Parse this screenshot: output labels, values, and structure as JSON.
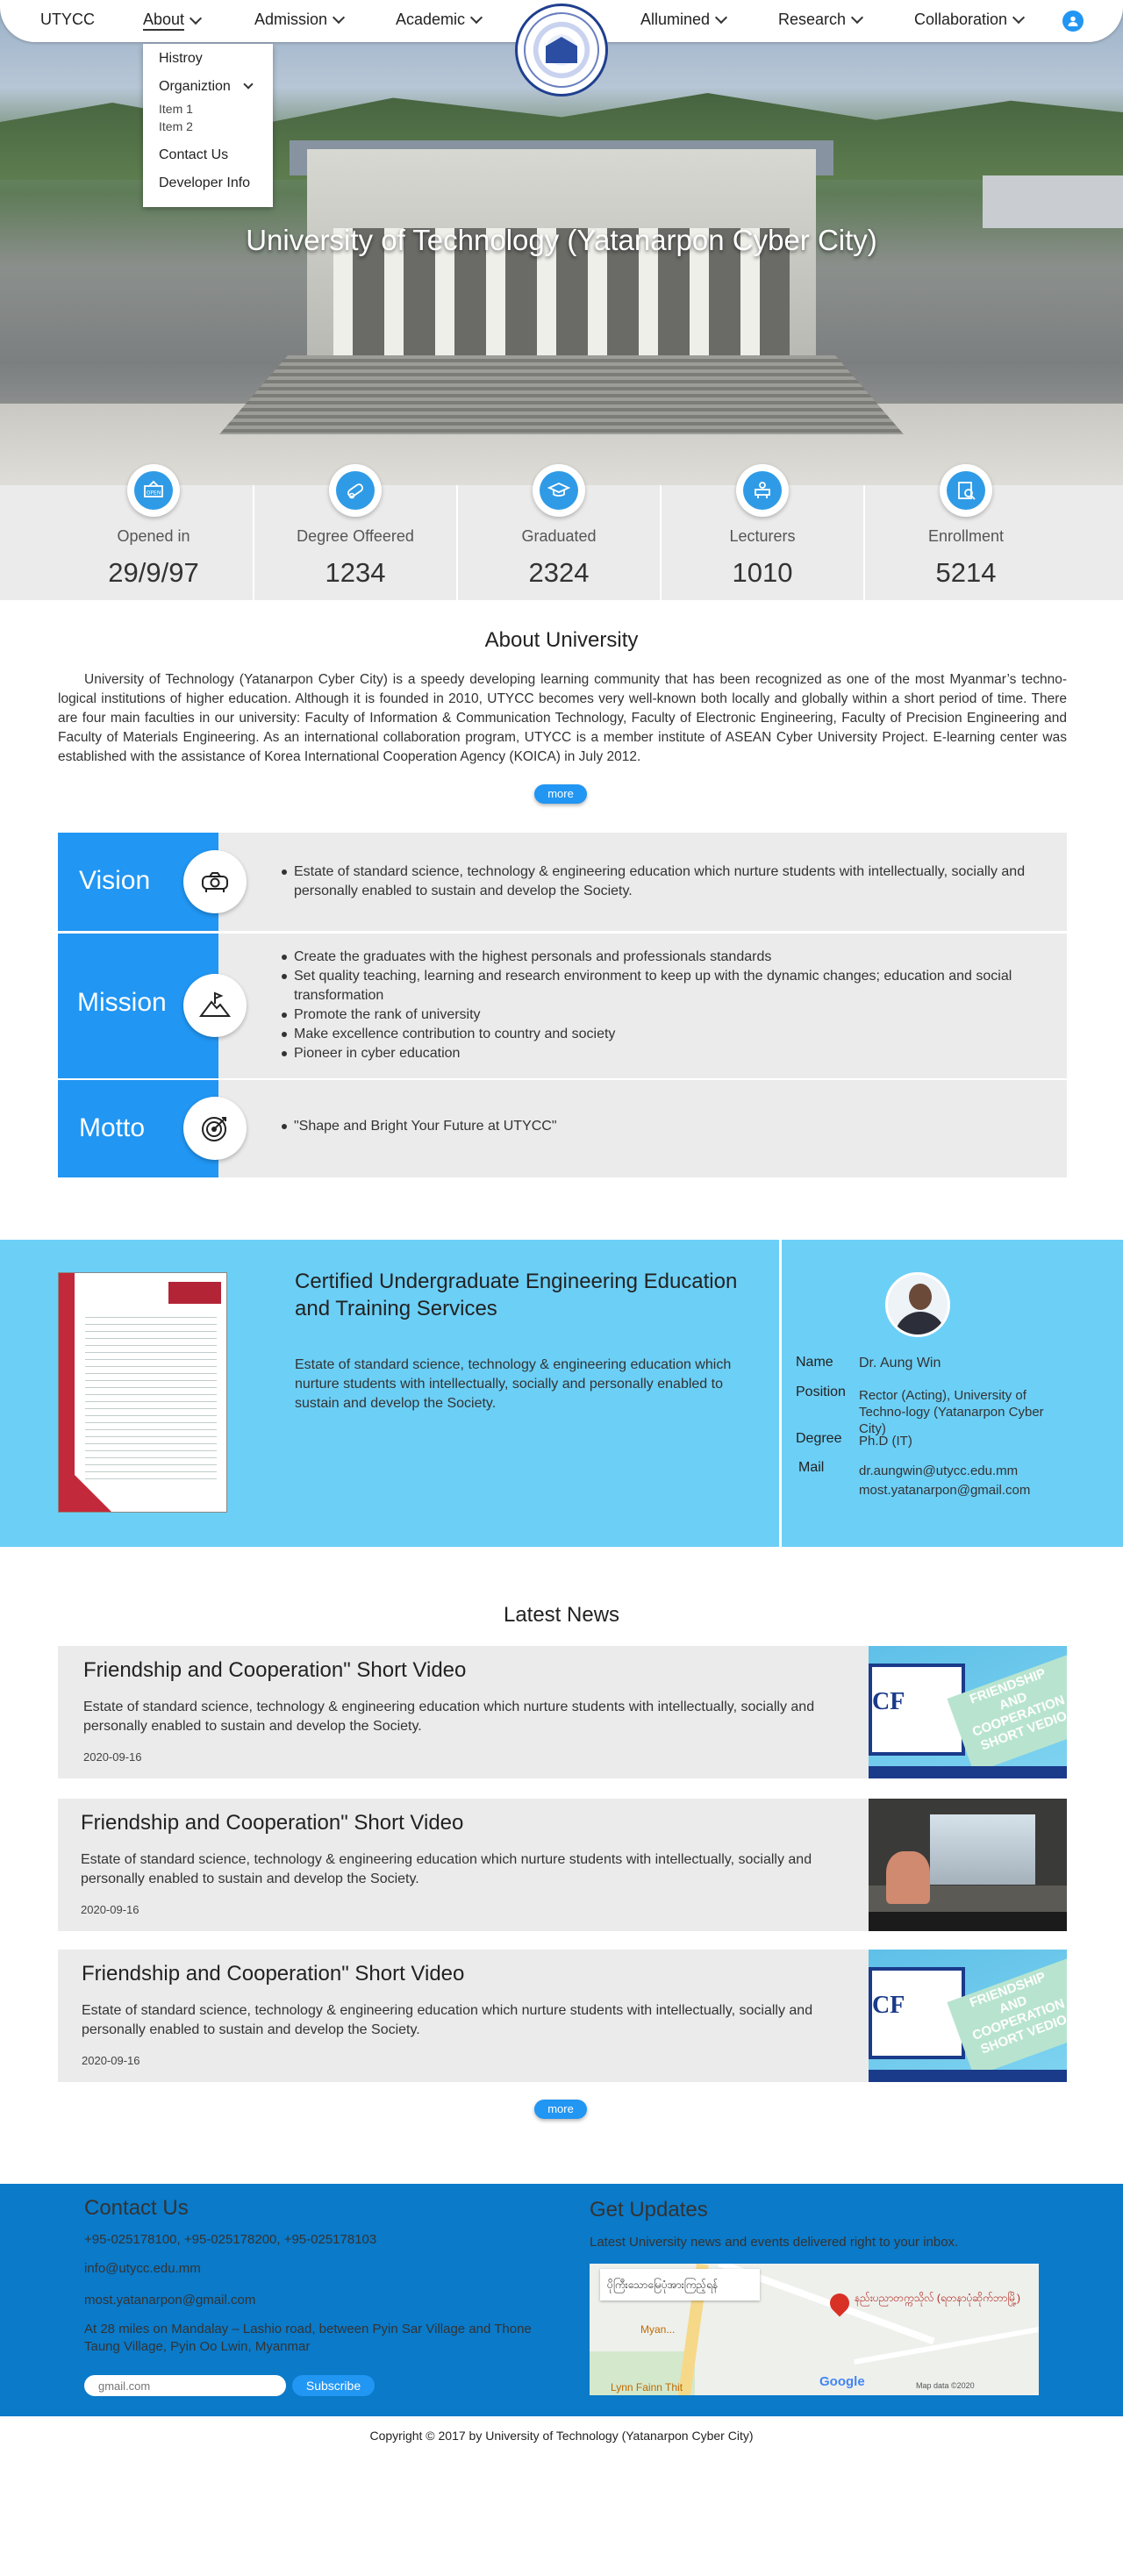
{
  "nav": {
    "brand": "UTYCC",
    "items": [
      {
        "label": "About"
      },
      {
        "label": "Admission"
      },
      {
        "label": "Academic"
      },
      {
        "label": "Allumined"
      },
      {
        "label": "Research"
      },
      {
        "label": "Collaboration"
      }
    ],
    "dropdown": {
      "histroy": "Histroy",
      "organiztion": "Organiztion",
      "item1": "Item 1",
      "item2": "Item 2",
      "contact": "Contact Us",
      "developer": "Developer Info"
    },
    "user_icon": "user-icon"
  },
  "hero": {
    "title": "University of Technology (Yatanarpon Cyber City)"
  },
  "stats": [
    {
      "icon": "open-sign-icon",
      "label": "Opened in",
      "value": "29/9/97"
    },
    {
      "icon": "diploma-icon",
      "label": "Degree Offeered",
      "value": "1234"
    },
    {
      "icon": "graduation-cap-icon",
      "label": "Graduated",
      "value": "2324"
    },
    {
      "icon": "lecturer-icon",
      "label": "Lecturers",
      "value": "1010"
    },
    {
      "icon": "enrollment-icon",
      "label": "Enrollment",
      "value": "5214"
    }
  ],
  "about": {
    "title": "About University",
    "text": "University of Technology (Yatanarpon Cyber City) is a speedy developing learning community that has been recognized as one of the most Myanmar’s techno-logical institutions of higher education. Although it is founded in 2010, UTYCC becomes very well-known both locally and globally within a short period of time. There are four main faculties in our university: Faculty of Information & Communication Technology, Faculty of Electronic Engineering, Faculty of Precision Engineering and Faculty of Materials Engineering. As an international collaboration program, UTYCC is a member institute of ASEAN Cyber University Project. E-learning center was established with the assistance of Korea International Cooperation Agency (KOICA) in July 2012.",
    "more": "more"
  },
  "vision": {
    "title": "Vision",
    "icon": "projector-icon",
    "items": [
      "Estate of standard science, technology & engineering education which nurture students with intellectually, socially and personally enabled to sustain and develop the Society."
    ]
  },
  "mission": {
    "title": "Mission",
    "icon": "mountain-flag-icon",
    "items": [
      "Create the graduates with the highest personals and professionals standards",
      "Set quality teaching, learning and research environment to keep up with the dynamic changes; education and social transformation",
      "Promote the rank of university",
      "Make excellence contribution to country and society",
      "Pioneer in cyber education"
    ]
  },
  "motto": {
    "title": "Motto",
    "icon": "target-icon",
    "items": [
      "\"Shape and Bright Your Future at UTYCC\""
    ]
  },
  "certification": {
    "title": "Certified Undergraduate Engineering Education and Training Services",
    "desc": "Estate of standard science, technology & engineering education which nurture students with intellectually, socially and personally enabled to sustain and develop the Society.",
    "rector": {
      "name_label": "Name",
      "name": "Dr. Aung Win",
      "position_label": "Position",
      "position": "Rector (Acting), University of Techno-logy (Yatanarpon Cyber City)",
      "degree_label": "Degree",
      "degree": "Ph.D (IT)",
      "mail_label": "Mail",
      "mail1": "dr.aungwin@utycc.edu.mm",
      "mail2": "most.yatanarpon@gmail.com"
    }
  },
  "news": {
    "title": "Latest News",
    "more": "more",
    "thumb_label": "FRIENDSHIP AND COOPERATION SHORT VEDIO",
    "thumb_cf": "CF",
    "items": [
      {
        "title": "Friendship and Cooperation\" Short Video",
        "desc": "Estate of standard science, technology & engineering education which nurture students with intellectually, socially and personally enabled to sustain and develop the Society.",
        "date": "2020-09-16"
      },
      {
        "title": "Friendship and Cooperation\" Short Video",
        "desc": "Estate of standard science, technology & engineering education which nurture students with intellectually, socially and personally enabled to sustain and develop the Society.",
        "date": "2020-09-16"
      },
      {
        "title": "Friendship and Cooperation\" Short Video",
        "desc": "Estate of standard science, technology & engineering education which nurture students with intellectually, socially and personally enabled to sustain and develop the Society.",
        "date": "2020-09-16"
      }
    ]
  },
  "footer": {
    "contact_title": "Contact Us",
    "phones": "+95-025178100, +95-025178200, +95-025178103",
    "email1": "info@utycc.edu.mm",
    "email2": "most.yatanarpon@gmail.com",
    "address": "At 28 miles on Mandalay – Lashio road, between Pyin Sar Village and Thone Taung Village, Pyin Oo Lwin, Myanmar",
    "email_placeholder": "gmail.com",
    "subscribe": "Subscribe",
    "updates_title": "Get Updates",
    "updates_text": "Latest University news and events delivered right to your inbox.",
    "map": {
      "label": "ပိုကြီးသောမြေပုံအားကြည့်ရန်",
      "pin_label": "နည်းပညာတက္ကသိုလ် (ရတနာပုံဆိုက်ဘာမြို့)",
      "poi1": "Myan...",
      "poi2": "Lynn Fainn Thit",
      "brand": "Google",
      "map_data": "Map data ©2020"
    },
    "copyright": "Copyright © 2017 by University of Technology (Yatanarpon Cyber City)"
  }
}
